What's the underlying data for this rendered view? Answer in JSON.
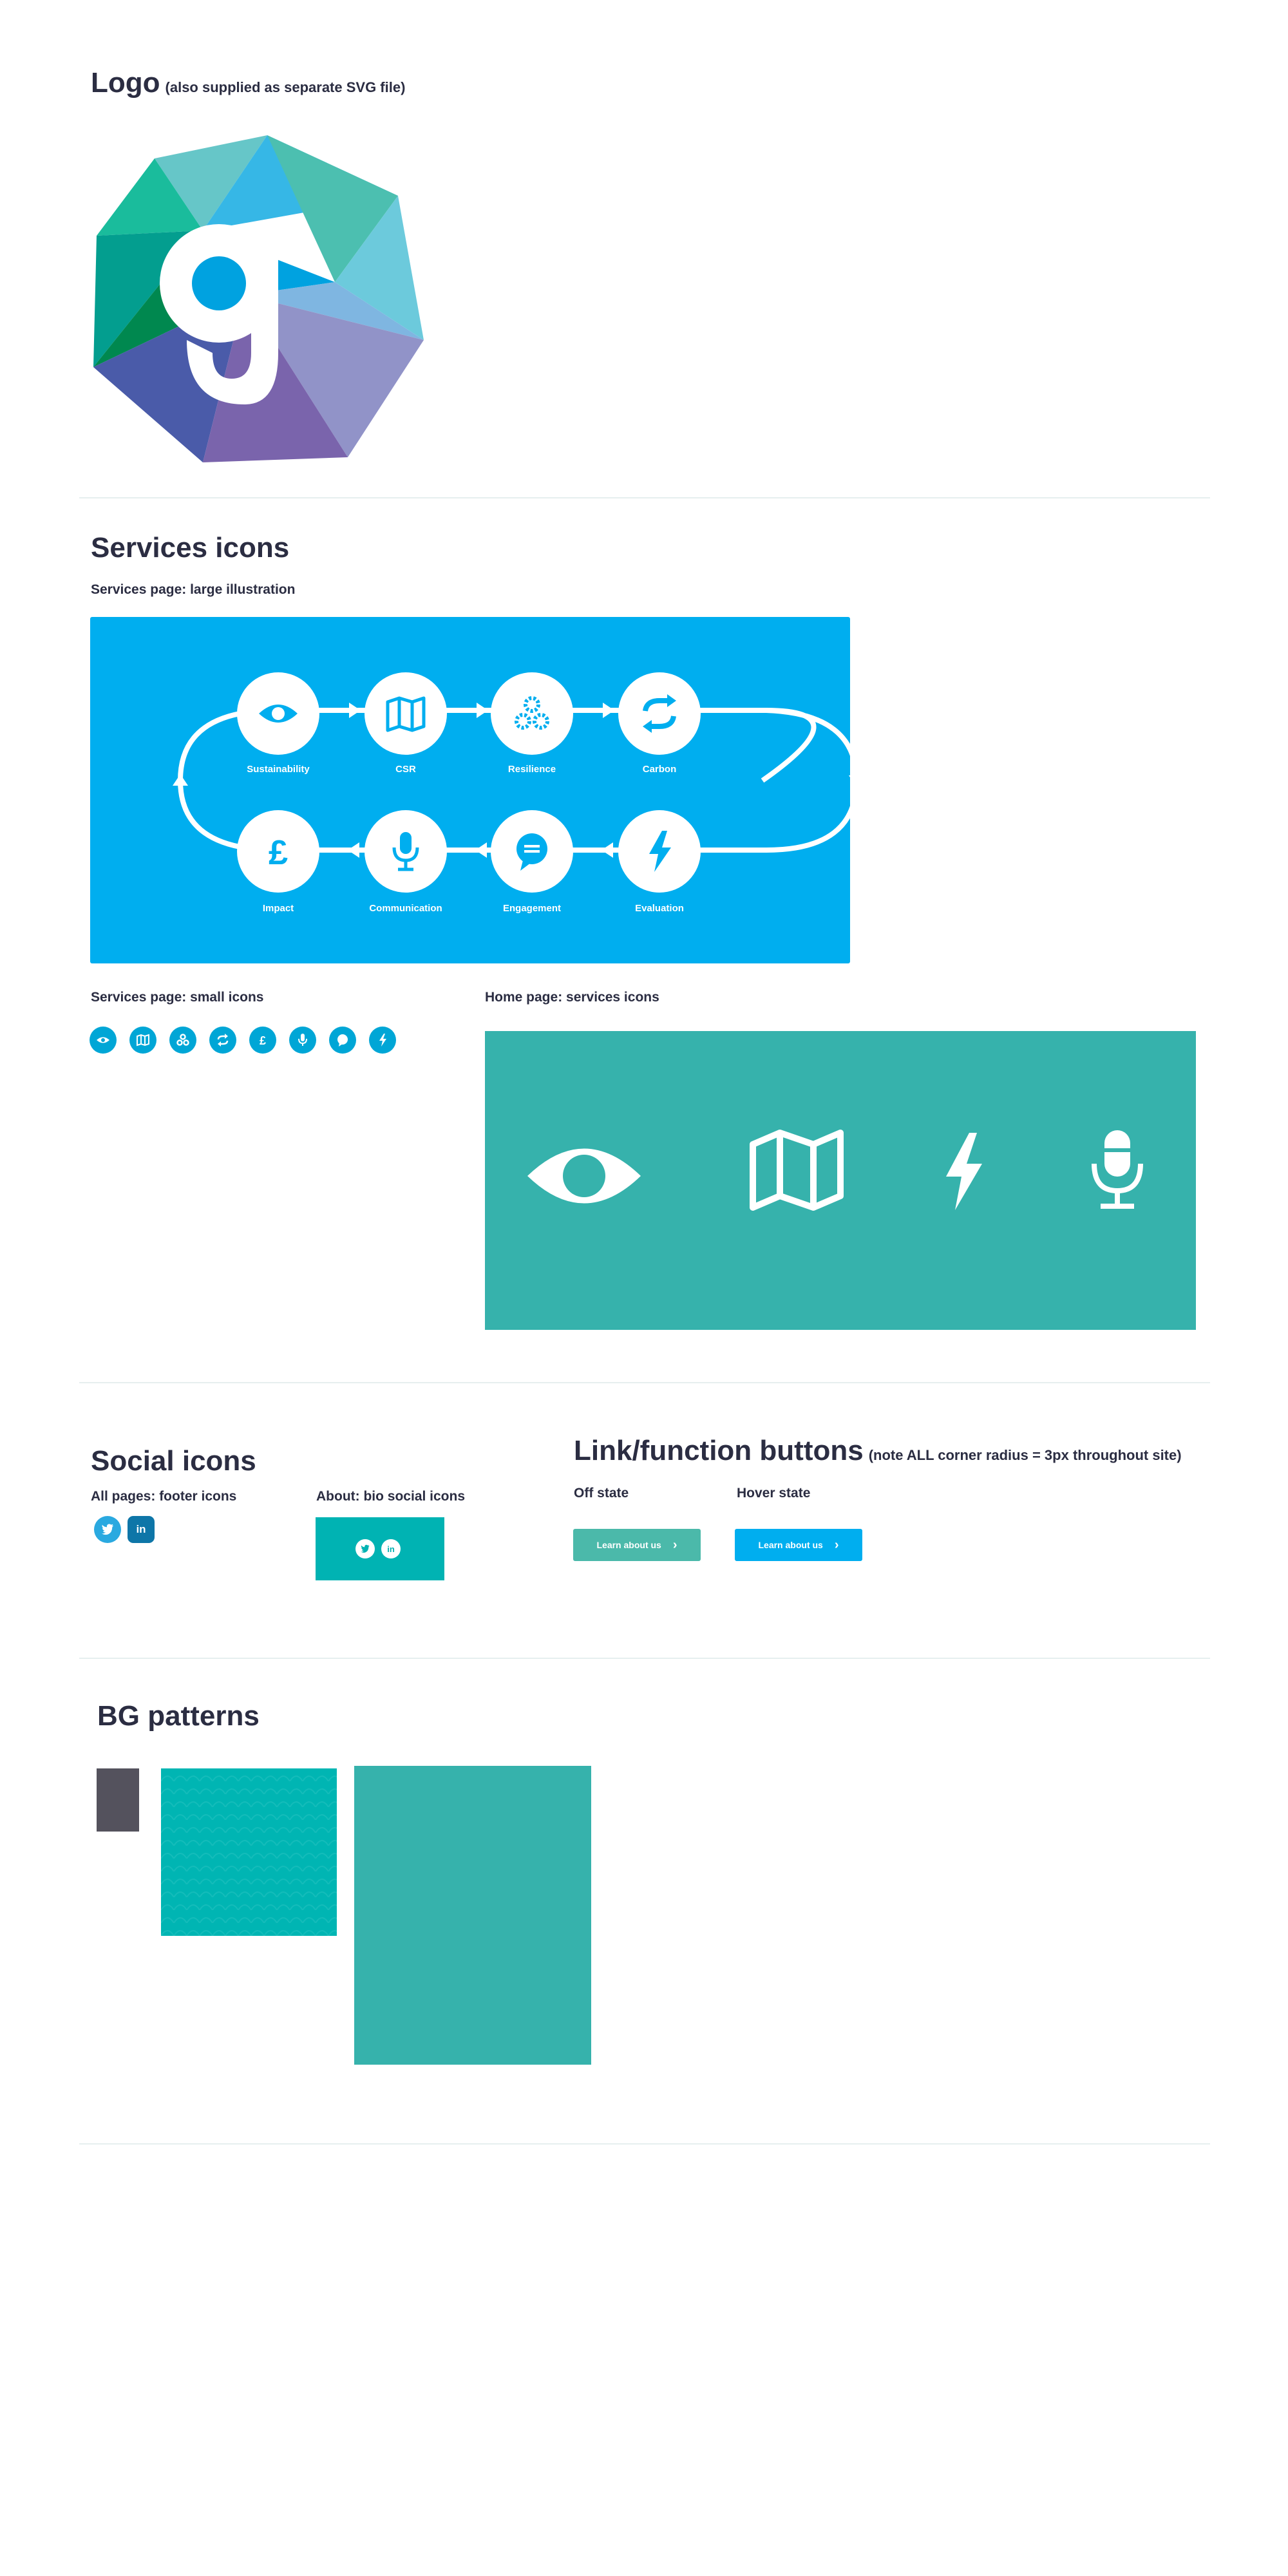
{
  "logo": {
    "title": "Logo",
    "note": "(also supplied as separate SVG file)",
    "letter": "g"
  },
  "services": {
    "title": "Services icons",
    "large_label": "Services page: large illustration",
    "small_label": "Services page: small icons",
    "home_label": "Home page: services icons",
    "illustration_bg": "#00aeef",
    "home_bg": "#36b2ac",
    "top_row": [
      "Sustainability",
      "CSR",
      "Resilience",
      "Carbon"
    ],
    "bottom_row": [
      "Impact",
      "Communication",
      "Engagement",
      "Evaluation"
    ],
    "small_icons": [
      "eye-icon",
      "map-icon",
      "gears-icon",
      "refresh-icon",
      "pound-icon",
      "microphone-icon",
      "chat-icon",
      "lightning-icon"
    ],
    "home_icons": [
      "eye-icon",
      "map-icon",
      "lightning-icon",
      "microphone-icon"
    ],
    "pound_symbol": "£"
  },
  "social": {
    "title": "Social icons",
    "footer_label": "All pages: footer icons",
    "bio_label": "About: bio social icons",
    "twitter_icon": "twitter-icon",
    "linkedin_icon": "linkedin-icon",
    "linkedin_text": "in",
    "bio_bg": "#00b3b3",
    "twitter_color": "#2aa9e0",
    "linkedin_color": "#0e76a8"
  },
  "buttons": {
    "title": "Link/function buttons",
    "note": "(note ALL corner radius = 3px throughout site)",
    "off_label": "Off state",
    "hover_label": "Hover state",
    "button_text": "Learn about us",
    "off_color": "#4bb9aa",
    "hover_color": "#00aeef",
    "chevron": "›"
  },
  "patterns": {
    "title": "BG patterns",
    "swatches": [
      "#54525d",
      "#00b5b3",
      "#36b2ac"
    ]
  }
}
